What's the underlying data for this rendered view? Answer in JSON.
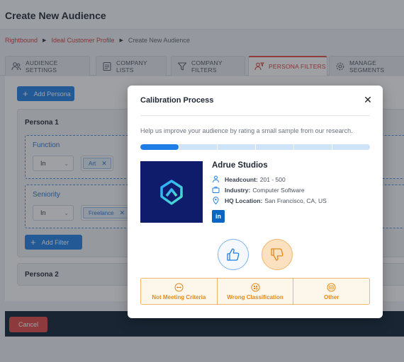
{
  "page": {
    "title": "Create New Audience",
    "breadcrumb": [
      "Rightbound",
      "Ideal Customer Profile",
      "Create New Audience"
    ],
    "tabs": [
      {
        "label": "AUDIENCE SETTINGS",
        "icon": "people-icon"
      },
      {
        "label": "COMPANY LISTS",
        "icon": "list-icon"
      },
      {
        "label": "COMPANY FILTERS",
        "icon": "filter-icon"
      },
      {
        "label": "PERSONA FILTERS",
        "icon": "persona-icon",
        "active": true
      },
      {
        "label": "MANAGE SEGMENTS",
        "icon": "gear-icon"
      }
    ],
    "add_persona_label": "Add Persona",
    "persona1": {
      "title": "Persona 1",
      "function": {
        "label": "Function",
        "operator": "In",
        "tag": "Art"
      },
      "seniority": {
        "label": "Seniority",
        "operator": "In",
        "tag": "Freelance"
      },
      "add_filter_label": "Add Filter"
    },
    "persona2": {
      "title": "Persona 2"
    },
    "cancel_label": "Cancel"
  },
  "modal": {
    "title": "Calibration Process",
    "close_symbol": "✕",
    "help_text": "Help us improve your audience by rating a small sample from our research.",
    "progress": {
      "completed": 1,
      "total": 6
    },
    "company": {
      "name": "Adrue Studios",
      "headcount_label": "Headcount:",
      "headcount": "201 - 500",
      "industry_label": "Industry:",
      "industry": "Computer Software",
      "hq_label": "HQ Location:",
      "hq": "San Francisco, CA, US",
      "linkedin_label": "in"
    },
    "reasons": [
      "Not Meeting Criteria",
      "Wrong Classification",
      "Other"
    ],
    "colors": {
      "accent_blue": "#1f7ee6",
      "accent_orange": "#e08a1e",
      "brand_red": "#d83b3b",
      "logo_bg": "#0f1b6b"
    }
  }
}
